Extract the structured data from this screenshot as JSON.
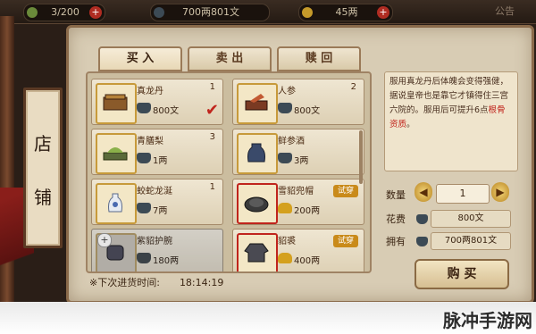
{
  "topbar": {
    "energy": "3/200",
    "copper": "700两801文",
    "silver": "45两",
    "notice": "公告"
  },
  "sidebar": {
    "title_chars": [
      "店",
      "铺"
    ]
  },
  "tabs": [
    {
      "label": "买 入",
      "active": true
    },
    {
      "label": "卖 出",
      "active": false
    },
    {
      "label": "赎 回",
      "active": false
    }
  ],
  "items": [
    {
      "name": "真龙丹",
      "qty": "1",
      "price": "800文",
      "coin": "copper",
      "selected": true
    },
    {
      "name": "人参",
      "qty": "2",
      "price": "800文",
      "coin": "copper",
      "selected": false
    },
    {
      "name": "青膳梨",
      "qty": "3",
      "price": "1两",
      "coin": "copper",
      "selected": false
    },
    {
      "name": "鲜参酒",
      "qty": "",
      "price": "3两",
      "coin": "copper",
      "selected": false
    },
    {
      "name": "蛟蛇龙涎",
      "qty": "1",
      "price": "7两",
      "coin": "copper",
      "selected": false
    },
    {
      "name": "雪貂兜帽",
      "qty": "",
      "price": "200两",
      "coin": "gold",
      "selected": false,
      "badge": "试穿"
    },
    {
      "name": "紫貂护腕",
      "qty": "",
      "price": "180两",
      "coin": "copper",
      "selected": false
    },
    {
      "name": "貂裘",
      "qty": "",
      "price": "400两",
      "coin": "gold",
      "selected": false,
      "badge": "试穿"
    }
  ],
  "restock": {
    "label": "※下次进货时间:",
    "time": "18:14:19"
  },
  "detail": {
    "desc_before": "服用真龙丹后体魄会变得强健，据说皇帝也是靠它才镇得住三宫六院的。服用后可提升6点",
    "desc_highlight": "根骨资质",
    "desc_after": "。"
  },
  "purchase": {
    "qty_label": "数量",
    "qty_value": "1",
    "cost_label": "花费",
    "cost_value": "800文",
    "own_label": "拥有",
    "own_value": "700两801文",
    "buy_label": "购 买"
  },
  "watermark": "脉冲手游网",
  "colors": {
    "accent_red": "#c0241c",
    "panel_bg": "#d8ccb4",
    "frame": "#8a6a4a"
  }
}
